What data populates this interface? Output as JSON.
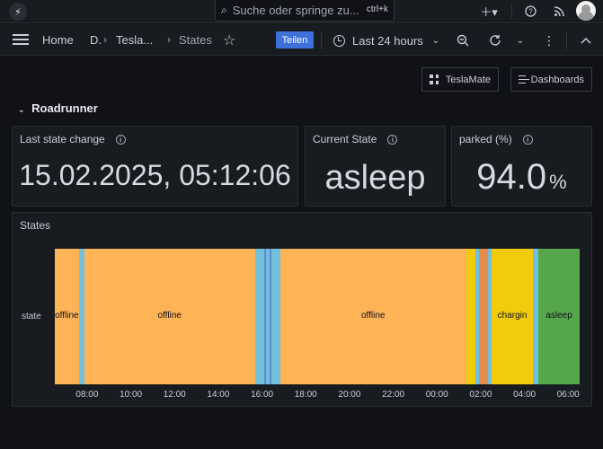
{
  "search": {
    "placeholder": "Suche oder springe zu...",
    "shortcut": "ctrl+k"
  },
  "breadcrumb": [
    {
      "label": "Home"
    },
    {
      "label": "D."
    },
    {
      "label": "Tesla..."
    },
    {
      "label": "States"
    }
  ],
  "toolbar": {
    "share_label": "Teilen",
    "time_range": "Last 24 hours"
  },
  "dashboard_links": {
    "teslamate": "TeslaMate",
    "dashboards": "Dashboards"
  },
  "row": {
    "title": "Roadrunner"
  },
  "panels": {
    "last_state_change": {
      "title": "Last state change",
      "value": "15.02.2025, 05:12:06"
    },
    "current_state": {
      "title": "Current State",
      "value": "asleep"
    },
    "parked": {
      "title": "parked (%)",
      "value": "94.0",
      "unit": "%"
    },
    "states": {
      "title": "States",
      "y_label": "state"
    }
  },
  "timeline": {
    "ticks": [
      "08:00",
      "10:00",
      "12:00",
      "14:00",
      "16:00",
      "18:00",
      "20:00",
      "22:00",
      "00:00",
      "02:00",
      "04:00",
      "06:00"
    ],
    "colors": {
      "offline": "#ffb357",
      "online": "#73bfd9",
      "driving": "#5a8dd6",
      "charging": "#f2cc0c",
      "asleep": "#56a64b",
      "updating": "#e58c4c"
    },
    "segments": [
      {
        "state": "offline",
        "start": "07:06",
        "end": "08:13",
        "label": "offline"
      },
      {
        "state": "online",
        "start": "08:13",
        "end": "08:28",
        "label": ""
      },
      {
        "state": "offline",
        "start": "08:28",
        "end": "16:15",
        "label": "offline"
      },
      {
        "state": "online",
        "start": "16:15",
        "end": "16:40",
        "label": ""
      },
      {
        "state": "driving",
        "start": "16:40",
        "end": "16:45",
        "label": ""
      },
      {
        "state": "online",
        "start": "16:45",
        "end": "16:55",
        "label": ""
      },
      {
        "state": "driving",
        "start": "16:55",
        "end": "17:00",
        "label": ""
      },
      {
        "state": "online",
        "start": "17:00",
        "end": "17:25",
        "label": ""
      },
      {
        "state": "offline",
        "start": "17:25",
        "end": "01:55",
        "label": "offline"
      },
      {
        "state": "charging",
        "start": "01:55",
        "end": "02:20",
        "label": ""
      },
      {
        "state": "online",
        "start": "02:20",
        "end": "02:30",
        "label": ""
      },
      {
        "state": "updating",
        "start": "02:30",
        "end": "02:55",
        "label": ""
      },
      {
        "state": "online",
        "start": "02:55",
        "end": "03:05",
        "label": ""
      },
      {
        "state": "charging",
        "start": "03:05",
        "end": "04:58",
        "label": "chargin"
      },
      {
        "state": "online",
        "start": "04:58",
        "end": "05:12",
        "label": ""
      },
      {
        "state": "asleep",
        "start": "05:12",
        "end": "07:06",
        "label": "asleep"
      }
    ]
  }
}
